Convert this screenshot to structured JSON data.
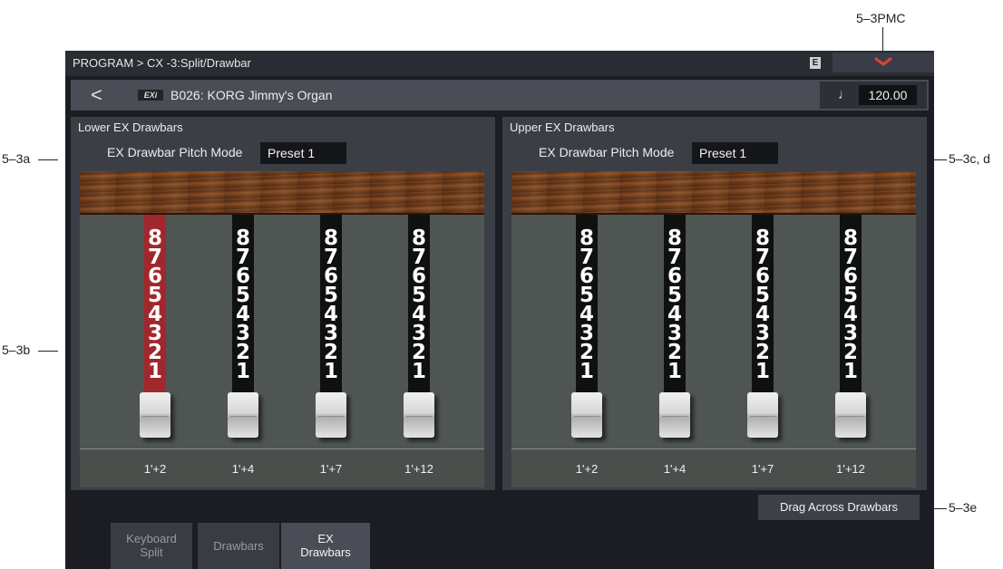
{
  "callouts": {
    "pmc": "5–3PMC",
    "a": "5–3a",
    "b": "5–3b",
    "cd": "5–3c, d",
    "e": "5–3e"
  },
  "header": {
    "breadcrumb": "PROGRAM > CX -3:Split/Drawbar",
    "mode_badge": "E",
    "pmc_icon": "chevron-down-icon"
  },
  "program": {
    "back_icon": "back-arrow-icon",
    "back_glyph": "<",
    "bank_badge": "EXi",
    "name": "B026: KORG Jimmy's Organ",
    "tempo_icon": "quarter-note-icon",
    "tempo_glyph": "♩",
    "tempo": "120.00"
  },
  "lower": {
    "title": "Lower EX Drawbars",
    "pitch_mode_label": "EX Drawbar Pitch Mode",
    "pitch_mode_value": "Preset 1",
    "drawbars": [
      {
        "label": "1'+2",
        "level": 8,
        "selected": true
      },
      {
        "label": "1'+4",
        "level": 8,
        "selected": false
      },
      {
        "label": "1'+7",
        "level": 8,
        "selected": false
      },
      {
        "label": "1'+12",
        "level": 8,
        "selected": false
      }
    ]
  },
  "upper": {
    "title": "Upper EX Drawbars",
    "pitch_mode_label": "EX Drawbar Pitch Mode",
    "pitch_mode_value": "Preset 1",
    "drawbars": [
      {
        "label": "1'+2",
        "level": 8,
        "selected": false
      },
      {
        "label": "1'+4",
        "level": 8,
        "selected": false
      },
      {
        "label": "1'+7",
        "level": 8,
        "selected": false
      },
      {
        "label": "1'+12",
        "level": 8,
        "selected": false
      }
    ]
  },
  "drawbar_scale": [
    "8",
    "7",
    "6",
    "5",
    "4",
    "3",
    "2",
    "1"
  ],
  "colors": {
    "selected_drawbar": "#a2272c",
    "drawbar": "#0f110f",
    "wood": "#7a4420"
  },
  "drag_button": "Drag Across Drawbars",
  "tabs": [
    {
      "line1": "Keyboard",
      "line2": "Split",
      "active": false
    },
    {
      "line1": "Drawbars",
      "line2": "",
      "active": false
    },
    {
      "line1": "EX",
      "line2": "Drawbars",
      "active": true
    }
  ]
}
